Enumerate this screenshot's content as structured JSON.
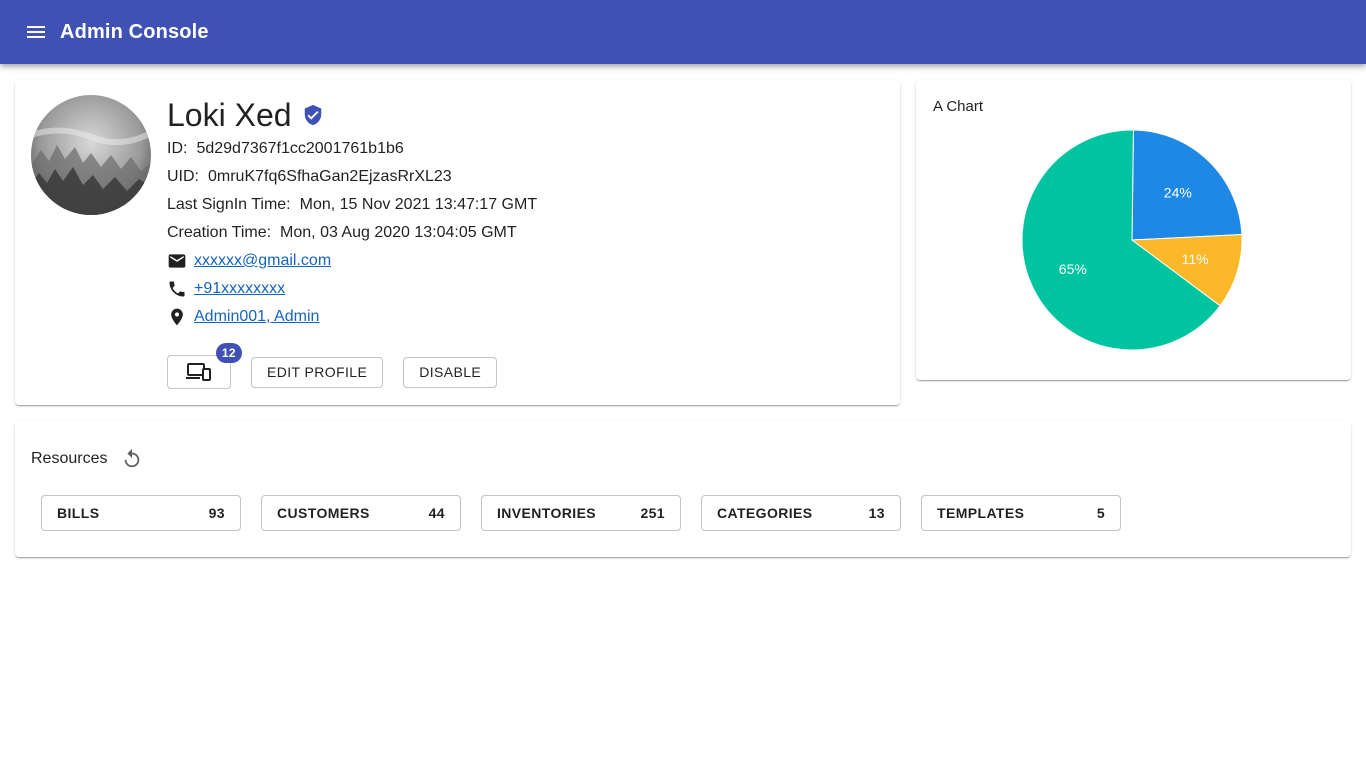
{
  "app": {
    "title": "Admin Console"
  },
  "profile": {
    "name": "Loki Xed",
    "id_label": "ID:",
    "id": "5d29d7367f1cc2001761b1b6",
    "uid_label": "UID:",
    "uid": "0mruK7fq6SfhaGan2EjzasRrXL23",
    "last_signin_label": "Last SignIn Time:",
    "last_signin": "Mon, 15 Nov 2021 13:47:17 GMT",
    "creation_label": "Creation Time:",
    "creation": "Mon, 03 Aug 2020 13:04:05 GMT",
    "email": "xxxxxx@gmail.com",
    "phone": "+91xxxxxxxx",
    "location": "Admin001, Admin",
    "devices_badge": "12",
    "edit_label": "EDIT PROFILE",
    "disable_label": "DISABLE"
  },
  "chart": {
    "title": "A Chart"
  },
  "chart_data": {
    "type": "pie",
    "title": "A Chart",
    "slices": [
      {
        "label": "24%",
        "value": 24,
        "color": "#1e88e5"
      },
      {
        "label": "11%",
        "value": 11,
        "color": "#fbb829"
      },
      {
        "label": "65%",
        "value": 65,
        "color": "#00c49f"
      }
    ]
  },
  "resources": {
    "title": "Resources",
    "items": [
      {
        "label": "BILLS",
        "count": "93"
      },
      {
        "label": "CUSTOMERS",
        "count": "44"
      },
      {
        "label": "INVENTORIES",
        "count": "251"
      },
      {
        "label": "CATEGORIES",
        "count": "13"
      },
      {
        "label": "TEMPLATES",
        "count": "5"
      }
    ]
  },
  "colors": {
    "primary": "#3f51b5",
    "link": "#1565c0"
  },
  "icons": {
    "menu": "menu-icon",
    "verified": "verified-shield-icon",
    "email": "email-icon",
    "phone": "phone-icon",
    "location": "location-pin-icon",
    "devices": "devices-icon",
    "refresh": "refresh-icon"
  }
}
